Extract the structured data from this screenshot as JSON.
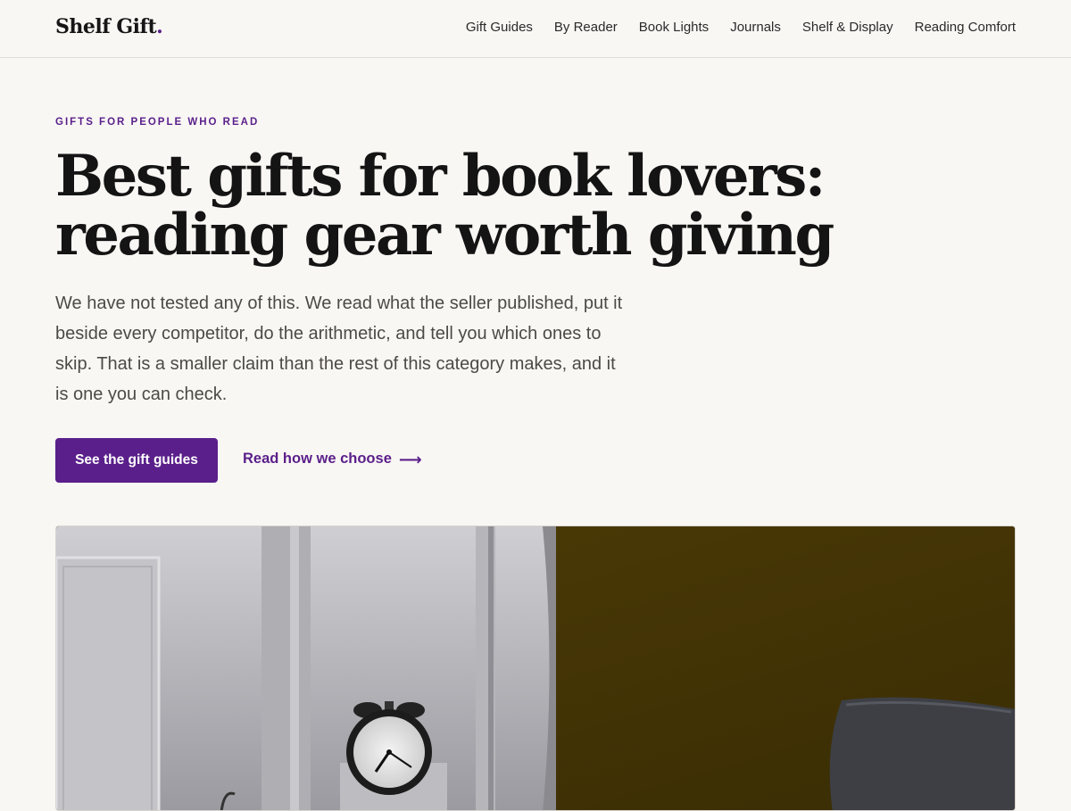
{
  "header": {
    "logo_text": "Shelf Gift",
    "logo_dot": ".",
    "nav": [
      {
        "label": "Gift Guides"
      },
      {
        "label": "By Reader"
      },
      {
        "label": "Book Lights"
      },
      {
        "label": "Journals"
      },
      {
        "label": "Shelf & Display"
      },
      {
        "label": "Reading Comfort"
      }
    ]
  },
  "hero": {
    "eyebrow": "GIFTS FOR PEOPLE WHO READ",
    "headline_line1": "Best gifts for book lovers:",
    "headline_line2": "reading gear worth giving",
    "lede": "We have not tested any of this. We read what the seller published, put it beside every competitor, do the arithmetic, and tell you which ones to skip. That is a smaller claim than the rest of this category makes, and it is one you can check.",
    "primary_cta": "See the gift guides",
    "secondary_cta": "Read how we choose",
    "secondary_cta_icon": "arrow-right-icon"
  },
  "colors": {
    "accent": "#5a1f8a",
    "background": "#f9f7f4",
    "wall_mustard": "#4a3a0a",
    "wall_grey": "#c9c8cc"
  }
}
